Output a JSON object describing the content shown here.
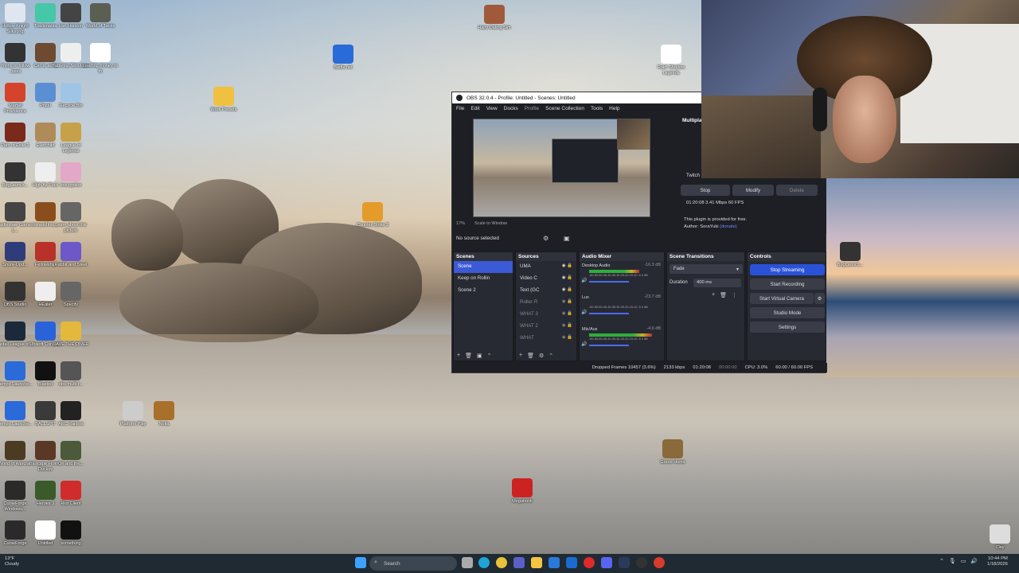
{
  "desktop": {
    "icons": [
      {
        "label": "Hollow Knight Silksong",
        "color": "#dfe6f0"
      },
      {
        "label": "Trackmania",
        "color": "#45c7a8"
      },
      {
        "label": "Iron Horizon",
        "color": "#444"
      },
      {
        "label": "World of Tanks",
        "color": "#5a5f52"
      },
      {
        "label": "Trying to follow ..ases",
        "color": "#333"
      },
      {
        "label": "Call to arms",
        "color": "#6d4a30"
      },
      {
        "label": "Tabletop Simulator",
        "color": "#eee"
      },
      {
        "label": "Leading money to th",
        "color": "#fff"
      },
      {
        "label": "Starfall Providence",
        "color": "#d4432b"
      },
      {
        "label": "Prizel",
        "color": "#5b8fd3"
      },
      {
        "label": "Recycle Bin",
        "color": "#9fc5e6"
      },
      {
        "label": "Path of Exile 2",
        "color": "#7a2a1a"
      },
      {
        "label": "Everchild",
        "color": "#b08b5a"
      },
      {
        "label": "League of Legends",
        "color": "#c7a149"
      },
      {
        "label": "BogLaunch...",
        "color": "#333"
      },
      {
        "label": "High As Fuck",
        "color": "#eee"
      },
      {
        "label": "Inscryption",
        "color": "#e3a7c8"
      },
      {
        "label": "Battlestate Games L...",
        "color": "#444"
      },
      {
        "label": "IntrepidInst...",
        "color": "#8a4e1c"
      },
      {
        "label": "Learn about this picture",
        "color": "#666"
      },
      {
        "label": "Shure-Upd...",
        "color": "#2e3d7a"
      },
      {
        "label": "Fellowship",
        "color": "#b8322a"
      },
      {
        "label": "Rabbit and Steel",
        "color": "#6c58c9"
      },
      {
        "label": "OBS Studio",
        "color": "#333"
      },
      {
        "label": "HEater",
        "color": "#eee"
      },
      {
        "label": "Specify",
        "color": "#666"
      },
      {
        "label": "Install League of...",
        "color": "#1b2a3a"
      },
      {
        "label": "Ubisoft Connect",
        "color": "#2a62d9"
      },
      {
        "label": "DAVE THE DIVER",
        "color": "#e4b83c"
      },
      {
        "label": "Tempo Launche...",
        "color": "#2a6ad9"
      },
      {
        "label": "Blasted",
        "color": "#111"
      },
      {
        "label": "obs-multi-r...",
        "color": "#555"
      },
      {
        "label": "Tempo Launche...",
        "color": "#2a6ad9"
      },
      {
        "label": "BALLSPIT",
        "color": "#3a3a3a"
      },
      {
        "label": "ARC Raiders",
        "color": "#222"
      },
      {
        "label": "World of Warcraft",
        "color": "#4a3b22"
      },
      {
        "label": "Escape From Duckov",
        "color": "#5a3826"
      },
      {
        "label": "Ori and the...",
        "color": "#4a5a3a"
      },
      {
        "label": "CurseForge Windows...",
        "color": "#2a2a2a"
      },
      {
        "label": "Heroes 3",
        "color": "#3b5a2a"
      },
      {
        "label": "Riot Client",
        "color": "#d02c2c"
      },
      {
        "label": "CurseForge",
        "color": "#2a2a2a"
      },
      {
        "label": "Untitled",
        "color": "#fff"
      },
      {
        "label": "something",
        "color": "#111"
      },
      {
        "label": "Battle.net",
        "color": "#2a6ad9"
      },
      {
        "label": "Work Presets",
        "color": "#f0c040"
      },
      {
        "label": "Counter-Strike 2",
        "color": "#e49b2a"
      },
      {
        "label": "Platform Play",
        "color": "#ccc"
      },
      {
        "label": "Noita",
        "color": "#a8702a"
      },
      {
        "label": "Hairy Dating Sim",
        "color": "#a05a3a"
      },
      {
        "label": "Raid: Shadow Legends",
        "color": "#fff"
      },
      {
        "label": "BogLaunch...",
        "color": "#333"
      },
      {
        "label": "Clay",
        "color": "#ddd"
      },
      {
        "label": "Megabonk",
        "color": "#c22"
      },
      {
        "label": "Grand Hunts",
        "color": "#8a6a3a"
      }
    ]
  },
  "obs": {
    "title": "OBS 32.0.4 - Profile: Untitled - Scenes: Untitled",
    "menu": [
      "File",
      "Edit",
      "View",
      "Docks",
      "Profile",
      "Scene Collection",
      "Tools",
      "Help"
    ],
    "zoom": "17%",
    "scale_label": "Scale to Window",
    "no_source": "No source selected",
    "multiplugin": {
      "heading": "Multipla",
      "twitch": "Twitch",
      "stop": "Stop",
      "modify": "Modify",
      "delete": "Delete",
      "stats": "01:20:08  3.41 Mbps  60 FPS",
      "free": "This plugin is provided for free.",
      "author": "Author: SoraYuki",
      "donate": "(donate)"
    },
    "scenes": {
      "title": "Scenes",
      "items": [
        "Scene",
        "Keep on Rollin",
        "Scene 2"
      ]
    },
    "sources": {
      "title": "Sources",
      "items": [
        "UMA",
        "Video C",
        "Text (GC",
        "Roller R",
        "WHAT 3",
        "WHAT 2",
        "WHAT"
      ]
    },
    "audio": {
      "title": "Audio Mixer",
      "channels": [
        {
          "name": "Desktop Audio",
          "db": "-16.3 dB",
          "level": 0.72
        },
        {
          "name": "Lux",
          "db": "-23.7 dB",
          "level": 0.0
        },
        {
          "name": "Mic/Aux",
          "db": "-4.6 dB",
          "level": 0.9
        }
      ],
      "scale": "-60-55-50-45-40-35-30-25-20-15-10 -5  0 dB"
    },
    "transitions": {
      "title": "Scene Transitions",
      "type": "Fade",
      "duration_label": "Duration",
      "duration": "400 ms"
    },
    "controls": {
      "title": "Controls",
      "buttons": [
        "Stop Streaming",
        "Start Recording",
        "Start Virtual Camera",
        "Studio Mode",
        "Settings"
      ]
    },
    "status": {
      "dropped": "Dropped Frames 10457 (3.6%)",
      "bitrate": "2133 kbps",
      "stream_time": "01:20:08",
      "rec_time": "00:00:00",
      "cpu": "CPU: 3.0%",
      "fps": "60.00 / 60.00 FPS"
    }
  },
  "taskbar": {
    "weather_temp": "13°F",
    "weather_text": "Cloudy",
    "search_placeholder": "Search",
    "time": "10:44 PM",
    "date": "1/18/2026"
  }
}
